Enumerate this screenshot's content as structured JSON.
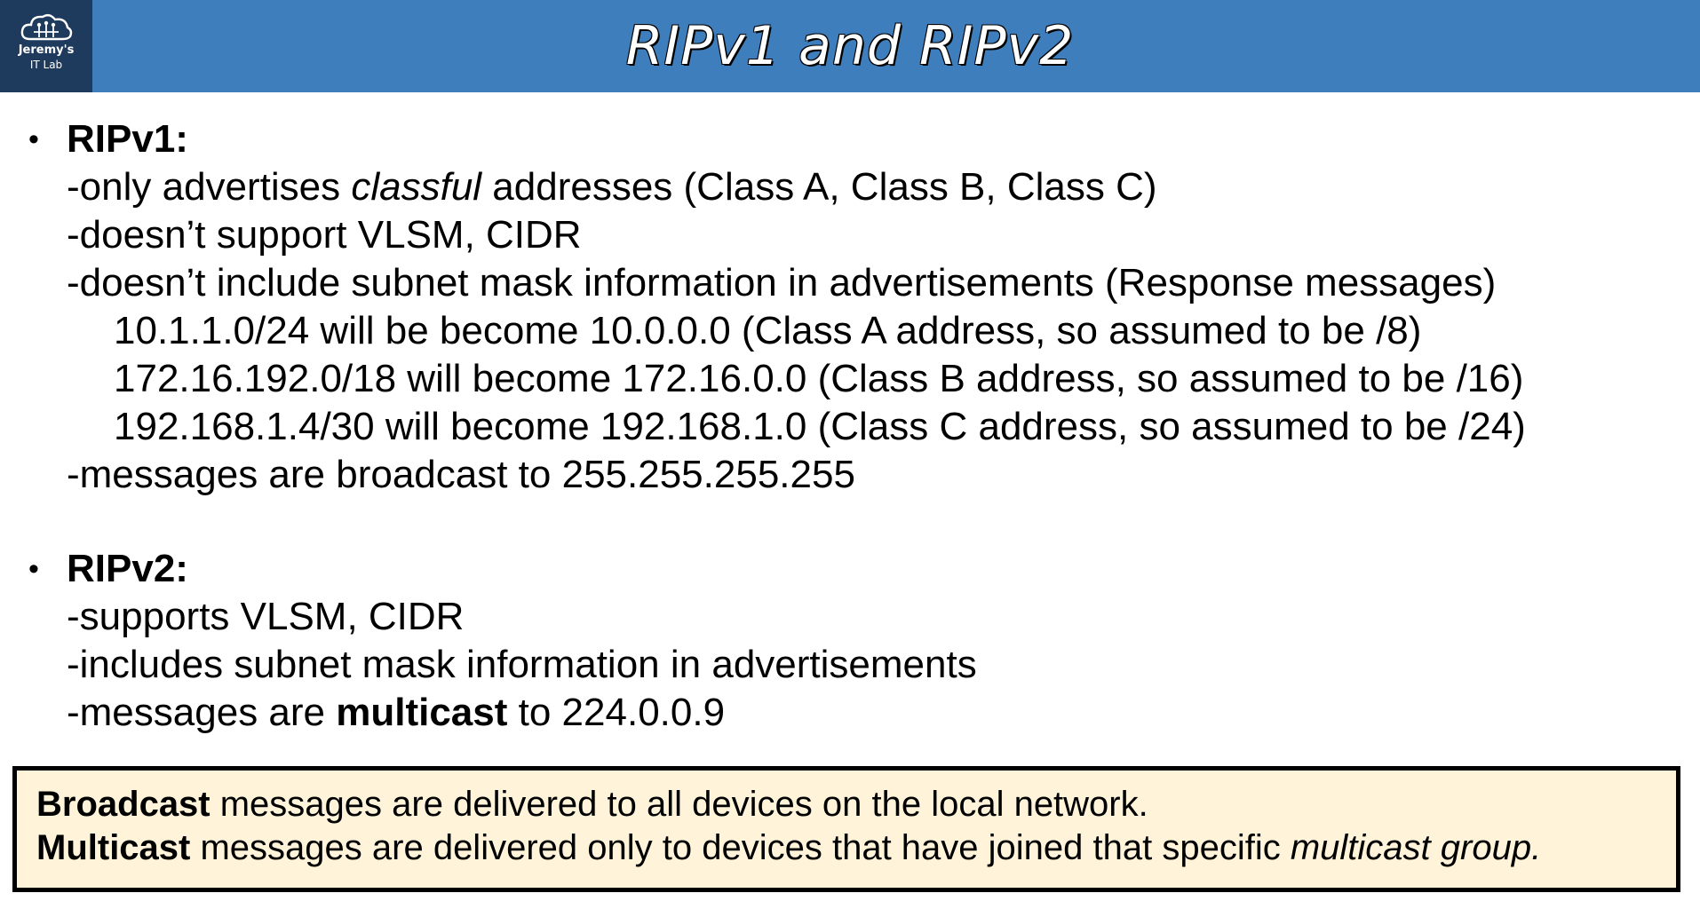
{
  "header": {
    "logo_line1": "Jeremy's",
    "logo_line2": "IT Lab",
    "title": "RIPv1 and RIPv2",
    "bg_color": "#3f7ebc",
    "logo_bg_color": "#1e3a5c"
  },
  "ripv1": {
    "heading": "RIPv1:",
    "line1_prefix": "-only advertises ",
    "line1_italic": "classful",
    "line1_suffix": " addresses (Class A, Class B, Class C)",
    "line2": "-doesn’t support VLSM, CIDR",
    "line3": "-doesn’t include subnet mask information in advertisements (Response messages)",
    "example1": "10.1.1.0/24 will be become 10.0.0.0 (Class A address, so assumed to be /8)",
    "example2": "172.16.192.0/18 will become 172.16.0.0 (Class B address, so assumed to be /16)",
    "example3": "192.168.1.4/30 will become 192.168.1.0 (Class C address, so assumed to be /24)",
    "line4": "-messages are broadcast to 255.255.255.255"
  },
  "ripv2": {
    "heading": "RIPv2:",
    "line1": "-supports VLSM, CIDR",
    "line2": "-includes subnet mask information in advertisements",
    "line3_prefix": "-messages are ",
    "line3_bold": "multicast",
    "line3_suffix": " to 224.0.0.9"
  },
  "note": {
    "bg_color": "#fff3d9",
    "line1_bold": "Broadcast",
    "line1_rest": " messages are delivered to all devices on the local network.",
    "line2_bold": "Multicast",
    "line2_rest": " messages are delivered only to devices that have joined that specific ",
    "line2_italic": "multicast group."
  }
}
